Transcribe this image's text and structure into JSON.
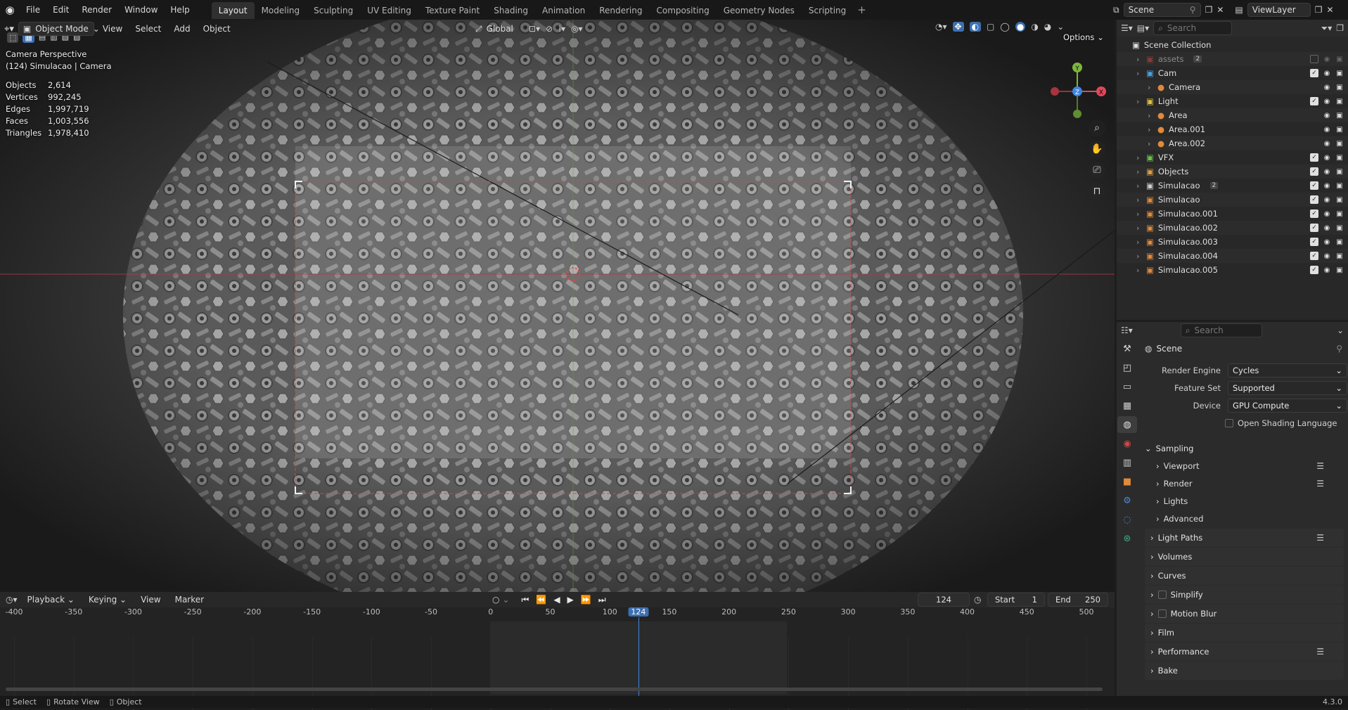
{
  "topbar": {
    "menus": [
      "File",
      "Edit",
      "Render",
      "Window",
      "Help"
    ],
    "workspaces": [
      "Layout",
      "Modeling",
      "Sculpting",
      "UV Editing",
      "Texture Paint",
      "Shading",
      "Animation",
      "Rendering",
      "Compositing",
      "Geometry Nodes",
      "Scripting"
    ],
    "active_workspace": "Layout",
    "scene": "Scene",
    "view_layer": "ViewLayer"
  },
  "viewport": {
    "mode": "Object Mode",
    "menus": [
      "View",
      "Select",
      "Add",
      "Object"
    ],
    "orientation": "Global",
    "options_label": "Options",
    "camera_title": "Camera Perspective",
    "camera_sub": "(124) Simulacao | Camera",
    "stats": [
      {
        "label": "Objects",
        "value": "2,614"
      },
      {
        "label": "Vertices",
        "value": "992,245"
      },
      {
        "label": "Edges",
        "value": "1,997,719"
      },
      {
        "label": "Faces",
        "value": "1,003,556"
      },
      {
        "label": "Triangles",
        "value": "1,978,410"
      }
    ],
    "gizmo": {
      "x": "X",
      "y": "Y",
      "z": "Z"
    }
  },
  "outliner": {
    "search_placeholder": "Search",
    "root": "Scene Collection",
    "rows": [
      {
        "name": "assets",
        "indent": 1,
        "badge": "2",
        "color": "#8a3a3a",
        "dim": true
      },
      {
        "name": "Cam",
        "indent": 1,
        "color": "#4aa3e0"
      },
      {
        "name": "Camera",
        "indent": 2,
        "color": "#e08a3a"
      },
      {
        "name": "Light",
        "indent": 1,
        "color": "#e0c23a"
      },
      {
        "name": "Area",
        "indent": 2,
        "color": "#e08a3a"
      },
      {
        "name": "Area.001",
        "indent": 2,
        "color": "#e08a3a"
      },
      {
        "name": "Area.002",
        "indent": 2,
        "color": "#e08a3a"
      },
      {
        "name": "VFX",
        "indent": 1,
        "color": "#6ac24a"
      },
      {
        "name": "Objects",
        "indent": 1,
        "color": "#e0a03a"
      },
      {
        "name": "Simulacao",
        "indent": 1,
        "badge": "2",
        "color": "#cfcfcf"
      },
      {
        "name": "Simulacao",
        "indent": 1,
        "color": "#e08a3a"
      },
      {
        "name": "Simulacao.001",
        "indent": 1,
        "color": "#e08a3a"
      },
      {
        "name": "Simulacao.002",
        "indent": 1,
        "color": "#e08a3a"
      },
      {
        "name": "Simulacao.003",
        "indent": 1,
        "color": "#e08a3a"
      },
      {
        "name": "Simulacao.004",
        "indent": 1,
        "color": "#e08a3a"
      },
      {
        "name": "Simulacao.005",
        "indent": 1,
        "color": "#e08a3a"
      }
    ]
  },
  "properties": {
    "search_placeholder": "Search",
    "context": "Scene",
    "render_engine_label": "Render Engine",
    "render_engine": "Cycles",
    "feature_set_label": "Feature Set",
    "feature_set": "Supported",
    "device_label": "Device",
    "device": "GPU Compute",
    "osl_label": "Open Shading Language",
    "sampling": "Sampling",
    "sampling_sub": [
      "Viewport",
      "Render",
      "Lights",
      "Advanced"
    ],
    "panels": [
      "Light Paths",
      "Volumes",
      "Curves",
      "Simplify",
      "Motion Blur",
      "Film",
      "Performance",
      "Bake"
    ]
  },
  "timeline": {
    "menus": [
      "Playback",
      "Keying",
      "View",
      "Marker"
    ],
    "current_frame": "124",
    "start_label": "Start",
    "start": "1",
    "end_label": "End",
    "end": "250",
    "ticks": [
      "-400",
      "-350",
      "-300",
      "-250",
      "-200",
      "-150",
      "-100",
      "-50",
      "0",
      "50",
      "100",
      "124",
      "150",
      "200",
      "250",
      "300",
      "350",
      "400",
      "450",
      "500"
    ]
  },
  "statusbar": {
    "items": [
      "Select",
      "Rotate View",
      "Object"
    ],
    "version": "4.3.0"
  }
}
